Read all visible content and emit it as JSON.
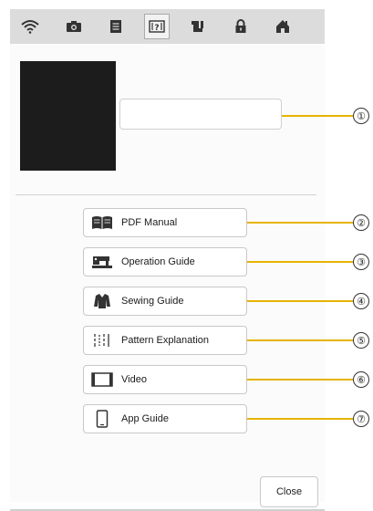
{
  "toolbar": {
    "icons": [
      "wifi-icon",
      "camera-icon",
      "document-icon",
      "help-icon",
      "machine-icon",
      "lock-icon",
      "home-icon"
    ]
  },
  "menu": {
    "items": [
      {
        "label": "PDF Manual",
        "icon": "book-icon"
      },
      {
        "label": "Operation Guide",
        "icon": "sewing-machine-icon"
      },
      {
        "label": "Sewing Guide",
        "icon": "shirt-icon"
      },
      {
        "label": "Pattern Explanation",
        "icon": "stitch-pattern-icon"
      },
      {
        "label": "Video",
        "icon": "film-icon"
      },
      {
        "label": "App Guide",
        "icon": "smartphone-icon"
      }
    ]
  },
  "close_label": "Close",
  "callouts": [
    "①",
    "②",
    "③",
    "④",
    "⑤",
    "⑥",
    "⑦"
  ],
  "colors": {
    "leader": "#e6b400",
    "toolbar_bg": "#dcdcdc",
    "preview_bg": "#1c1c1c"
  }
}
